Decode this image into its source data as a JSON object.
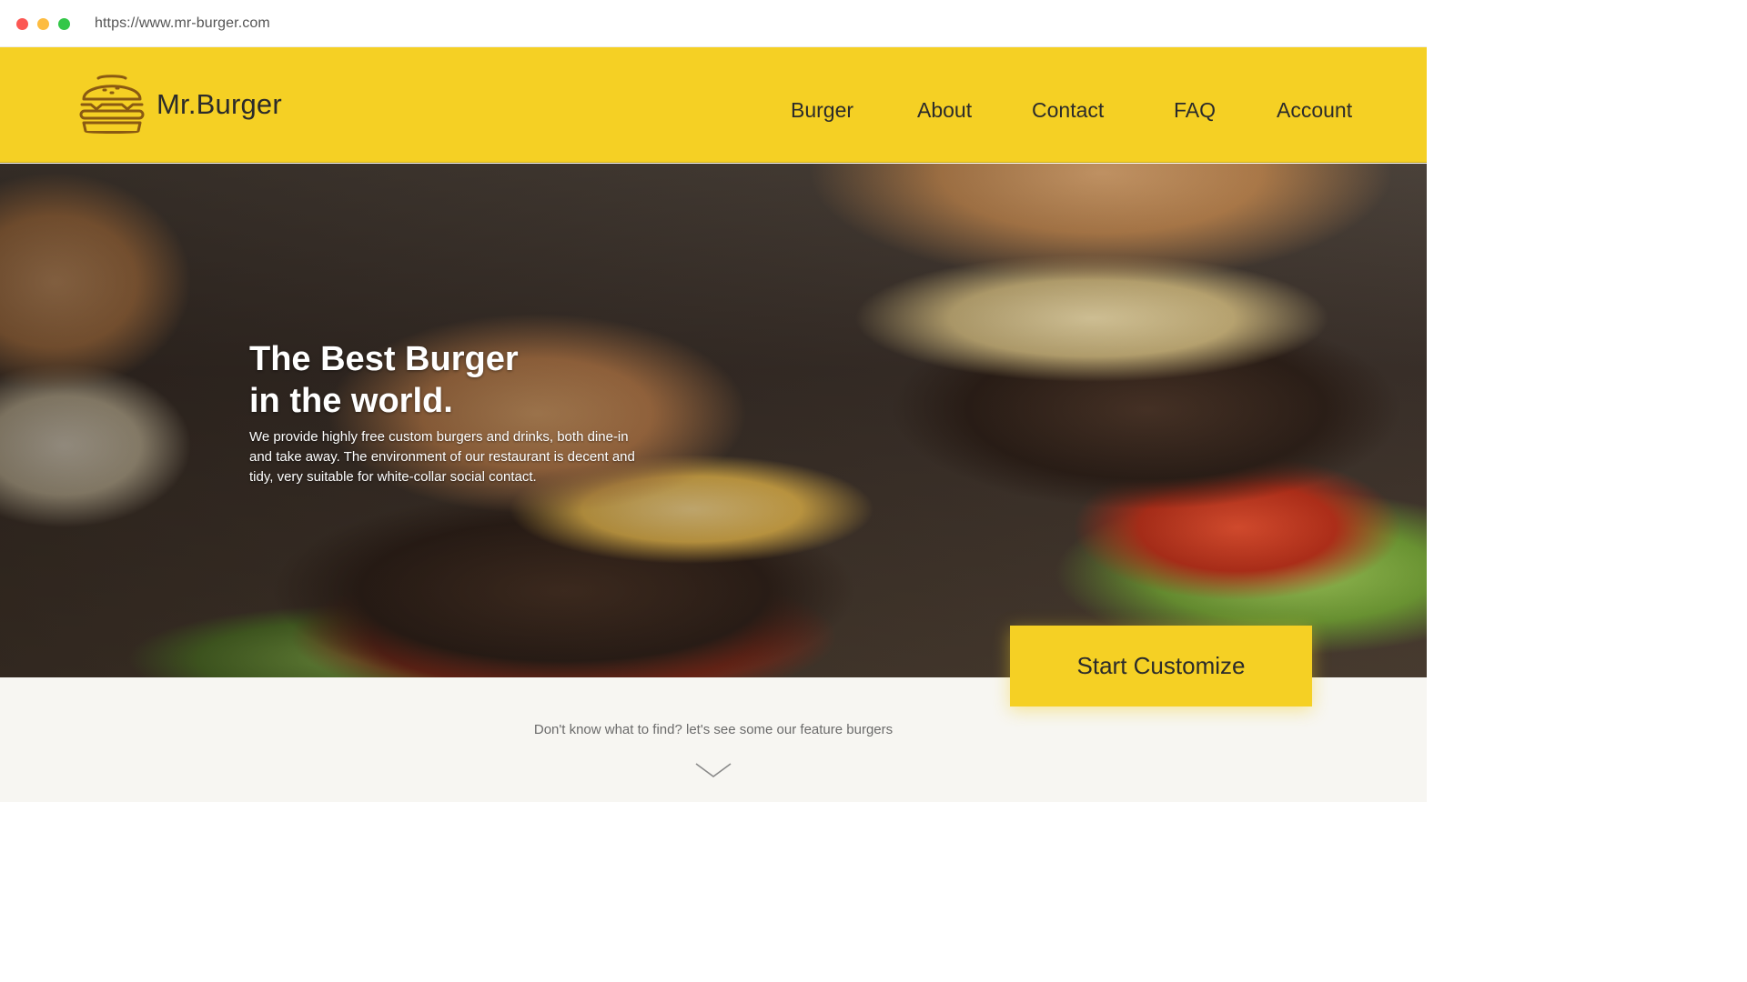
{
  "browser": {
    "url": "https://www.mr-burger.com",
    "traffic_lights": [
      "#fc5753",
      "#fdbc40",
      "#33c748"
    ]
  },
  "header": {
    "logo_text": "Mr.Burger",
    "logo_icon": "burger-icon",
    "background_color": "#f5d024",
    "nav": [
      {
        "label": "Burger"
      },
      {
        "label": "About"
      },
      {
        "label": "Contact"
      },
      {
        "label": "FAQ"
      },
      {
        "label": "Account"
      }
    ]
  },
  "hero": {
    "title_line1": "The Best Burger",
    "title_line2": "in the world.",
    "description": "We provide highly free custom burgers and drinks, both dine-in and take away. The environment of our restaurant is decent and tidy, very suitable for white-collar social contact.",
    "image": "burgers-photo"
  },
  "cta": {
    "label": "Start Customize",
    "color": "#f5d024"
  },
  "feature": {
    "text": "Don't know what to find? let's see some our feature burgers",
    "icon": "chevron-down-icon"
  }
}
